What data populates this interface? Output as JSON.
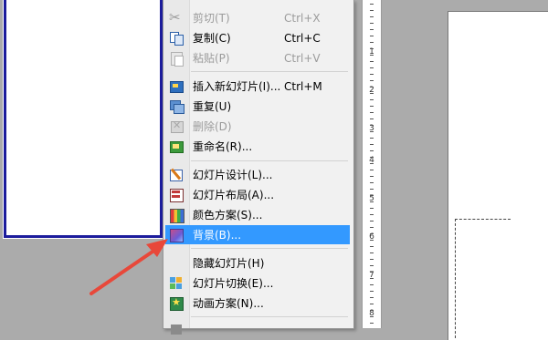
{
  "context_menu": {
    "items": [
      {
        "label": "剪切(T)",
        "shortcut": "Ctrl+X",
        "icon": "scissors-icon",
        "disabled": true
      },
      {
        "label": "复制(C)",
        "shortcut": "Ctrl+C",
        "icon": "copy-icon",
        "disabled": false
      },
      {
        "label": "粘贴(P)",
        "shortcut": "Ctrl+V",
        "icon": "paste-icon",
        "disabled": true
      },
      {
        "label": "插入新幻灯片(I)...",
        "shortcut": "Ctrl+M",
        "icon": "new-slide-icon",
        "disabled": false
      },
      {
        "label": "重复(U)",
        "shortcut": "",
        "icon": "duplicate-slide-icon",
        "disabled": false
      },
      {
        "label": "删除(D)",
        "shortcut": "",
        "icon": "delete-slide-icon",
        "disabled": true
      },
      {
        "label": "重命名(R)...",
        "shortcut": "",
        "icon": "rename-icon",
        "disabled": false
      },
      {
        "label": "幻灯片设计(L)...",
        "shortcut": "",
        "icon": "slide-design-icon",
        "disabled": false
      },
      {
        "label": "幻灯片布局(A)...",
        "shortcut": "",
        "icon": "slide-layout-icon",
        "disabled": false
      },
      {
        "label": "颜色方案(S)...",
        "shortcut": "",
        "icon": "color-scheme-icon",
        "disabled": false
      },
      {
        "label": "背景(B)...",
        "shortcut": "",
        "icon": "background-icon",
        "disabled": false,
        "highlighted": true
      },
      {
        "label": "隐藏幻灯片(H)",
        "shortcut": "",
        "icon": "",
        "disabled": false
      },
      {
        "label": "幻灯片切换(E)...",
        "shortcut": "",
        "icon": "slide-transition-icon",
        "disabled": false
      },
      {
        "label": "动画方案(N)...",
        "shortcut": "",
        "icon": "animation-scheme-icon",
        "disabled": false
      }
    ]
  },
  "ruler": {
    "numbers": [
      "1",
      "2",
      "3",
      "4",
      "5",
      "6",
      "7",
      "8"
    ]
  },
  "colors": {
    "highlight": "#3399ff",
    "thumbnail_border": "#1c1c9c",
    "arrow": "#e8483a"
  }
}
